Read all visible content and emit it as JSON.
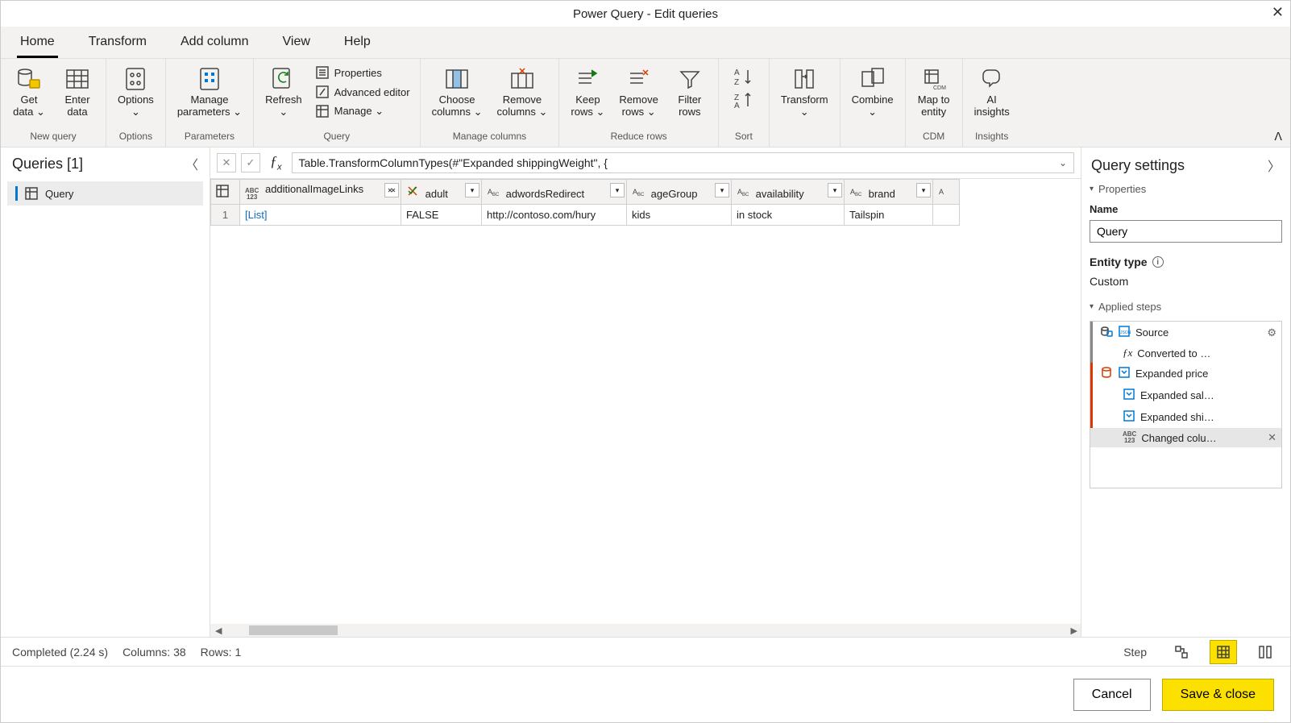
{
  "titlebar": {
    "title": "Power Query - Edit queries"
  },
  "menubar": {
    "tabs": [
      "Home",
      "Transform",
      "Add column",
      "View",
      "Help"
    ],
    "active": 0
  },
  "ribbon": {
    "groups": [
      {
        "label": "New query",
        "items": [
          {
            "id": "get-data",
            "label": "Get\ndata ⌄"
          },
          {
            "id": "enter-data",
            "label": "Enter\ndata"
          }
        ]
      },
      {
        "label": "Options",
        "items": [
          {
            "id": "options",
            "label": "Options\n⌄"
          }
        ]
      },
      {
        "label": "Parameters",
        "items": [
          {
            "id": "manage-parameters",
            "label": "Manage\nparameters ⌄"
          }
        ]
      },
      {
        "label": "Query",
        "items": [
          {
            "id": "refresh",
            "label": "Refresh\n⌄"
          }
        ],
        "mini": [
          {
            "id": "properties",
            "label": "Properties"
          },
          {
            "id": "advanced-editor",
            "label": "Advanced editor"
          },
          {
            "id": "manage",
            "label": "Manage ⌄"
          }
        ]
      },
      {
        "label": "Manage columns",
        "items": [
          {
            "id": "choose-columns",
            "label": "Choose\ncolumns ⌄"
          },
          {
            "id": "remove-columns",
            "label": "Remove\ncolumns ⌄"
          }
        ]
      },
      {
        "label": "Reduce rows",
        "items": [
          {
            "id": "keep-rows",
            "label": "Keep\nrows ⌄"
          },
          {
            "id": "remove-rows",
            "label": "Remove\nrows ⌄"
          },
          {
            "id": "filter-rows",
            "label": "Filter\nrows"
          }
        ]
      },
      {
        "label": "Sort",
        "items": [
          {
            "id": "sort",
            "label": ""
          }
        ]
      },
      {
        "label": "",
        "items": [
          {
            "id": "transform",
            "label": "Transform\n⌄"
          }
        ]
      },
      {
        "label": "",
        "items": [
          {
            "id": "combine",
            "label": "Combine\n⌄"
          }
        ]
      },
      {
        "label": "CDM",
        "items": [
          {
            "id": "map-to-entity",
            "label": "Map to\nentity"
          }
        ]
      },
      {
        "label": "Insights",
        "items": [
          {
            "id": "ai-insights",
            "label": "AI\ninsights"
          }
        ]
      }
    ]
  },
  "queriesPane": {
    "title": "Queries [1]",
    "items": [
      {
        "name": "Query"
      }
    ]
  },
  "formula": "Table.TransformColumnTypes(#\"Expanded shippingWeight\", {",
  "table": {
    "columns": [
      {
        "name": "additionalImageLinks",
        "type": "any",
        "selected": true,
        "expand": true
      },
      {
        "name": "adult",
        "type": "bool"
      },
      {
        "name": "adwordsRedirect",
        "type": "text"
      },
      {
        "name": "ageGroup",
        "type": "text"
      },
      {
        "name": "availability",
        "type": "text"
      },
      {
        "name": "brand",
        "type": "text"
      }
    ],
    "rows": [
      [
        "[List]",
        "FALSE",
        "http://contoso.com/hury",
        "kids",
        "in stock",
        "Tailspin"
      ]
    ]
  },
  "settings": {
    "title": "Query settings",
    "propertiesLabel": "Properties",
    "nameLabel": "Name",
    "nameValue": "Query",
    "entityTypeLabel": "Entity type",
    "entityTypeValue": "Custom",
    "appliedStepsLabel": "Applied steps",
    "steps": [
      {
        "label": "Source",
        "icon": "json",
        "cog": true,
        "line": "gray"
      },
      {
        "label": "Converted to …",
        "icon": "fx",
        "line": "gray"
      },
      {
        "label": "Expanded price",
        "icon": "expand",
        "line": "red"
      },
      {
        "label": "Expanded sal…",
        "icon": "expand",
        "line": "red"
      },
      {
        "label": "Expanded shi…",
        "icon": "expand",
        "line": "red"
      },
      {
        "label": "Changed colu…",
        "icon": "abc123",
        "active": true,
        "close": true
      }
    ]
  },
  "statusbar": {
    "completed": "Completed (2.24 s)",
    "columns": "Columns: 38",
    "rows": "Rows: 1",
    "stepLabel": "Step"
  },
  "footer": {
    "cancel": "Cancel",
    "save": "Save & close"
  }
}
